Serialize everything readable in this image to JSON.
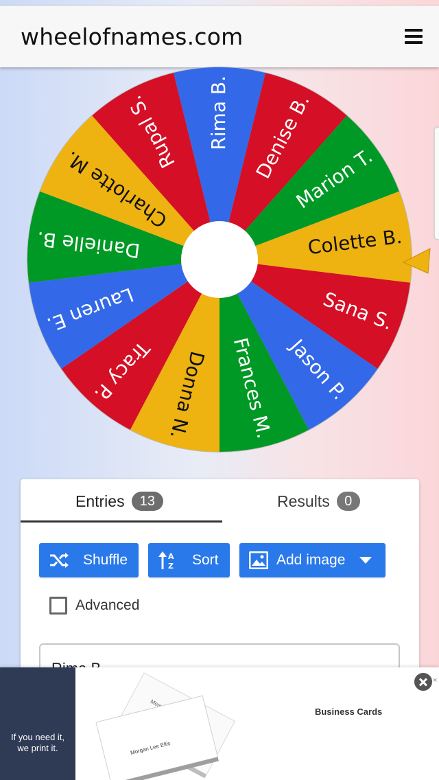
{
  "header": {
    "site_title": "wheelofnames.com",
    "menu_icon": "hamburger-menu-icon"
  },
  "wheel": {
    "entries": [
      {
        "name": "Rima B.",
        "color": "#3369e8"
      },
      {
        "name": "Denise B.",
        "color": "#d50f25"
      },
      {
        "name": "Marion T.",
        "color": "#009925"
      },
      {
        "name": "Colette B.",
        "color": "#eeb211"
      },
      {
        "name": "Sana S.",
        "color": "#d50f25"
      },
      {
        "name": "Jason P.",
        "color": "#3369e8"
      },
      {
        "name": "Frances M.",
        "color": "#009925"
      },
      {
        "name": "Donna N.",
        "color": "#eeb211"
      },
      {
        "name": "Tracy P.",
        "color": "#d50f25"
      },
      {
        "name": "Lauren E.",
        "color": "#3369e8"
      },
      {
        "name": "Danielle B.",
        "color": "#009925"
      },
      {
        "name": "Charlotte M.",
        "color": "#eeb211"
      },
      {
        "name": "Rupal S.",
        "color": "#d50f25"
      }
    ],
    "pointer_color": "#eeb211"
  },
  "tabs": {
    "entries_label": "Entries",
    "entries_count": "13",
    "results_label": "Results",
    "results_count": "0"
  },
  "buttons": {
    "shuffle": "Shuffle",
    "sort": "Sort",
    "add_image": "Add image"
  },
  "advanced": {
    "label": "Advanced",
    "checked": false
  },
  "entries_text": {
    "first_line": "Rima B."
  },
  "ad": {
    "slogan": "If you need it,\nwe print it.",
    "product": "Business Cards",
    "card_name": "Morgan Lee Ellis"
  },
  "colors": {
    "accent": "#2979ea",
    "blue": "#3369e8",
    "red": "#d50f25",
    "green": "#009925",
    "yellow": "#eeb211"
  }
}
